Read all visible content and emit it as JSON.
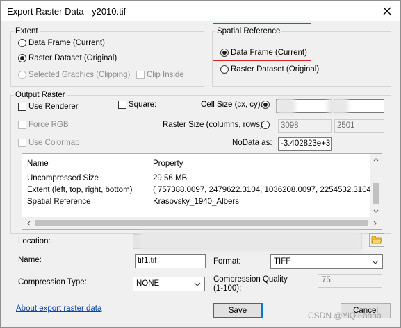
{
  "window": {
    "title": "Export Raster Data - y2010.tif"
  },
  "extent": {
    "legend": "Extent",
    "options": [
      {
        "label": "Data Frame (Current)",
        "checked": false
      },
      {
        "label": "Raster Dataset (Original)",
        "checked": true
      },
      {
        "label": "Selected Graphics (Clipping)",
        "checked": false,
        "disabled": true
      }
    ],
    "clip_inside": "Clip Inside"
  },
  "spatial_reference": {
    "legend": "Spatial Reference",
    "options": [
      {
        "label": "Data Frame (Current)",
        "checked": true
      },
      {
        "label": "Raster Dataset (Original)",
        "checked": false
      }
    ]
  },
  "output_raster": {
    "legend": "Output Raster",
    "use_renderer": "Use Renderer",
    "square": "Square:",
    "cell_size_label": "Cell Size (cx, cy):",
    "force_rgb": "Force RGB",
    "raster_size_label": "Raster Size (columns, rows):",
    "raster_columns": "3098",
    "raster_rows": "2501",
    "use_colormap": "Use Colormap",
    "nodata_label": "NoData as:",
    "nodata_value": "-3.402823e+3"
  },
  "properties": {
    "columns": [
      "Name",
      "Property"
    ],
    "rows": [
      {
        "name": "Uncompressed Size",
        "value": "29.56 MB"
      },
      {
        "name": "Extent (left, top, right, bottom)",
        "value": "( 757388.0097, 2479622.3104, 1036208.0097, 2254532.3104 )"
      },
      {
        "name": "Spatial Reference",
        "value": "Krasovsky_1940_Albers"
      }
    ]
  },
  "location": {
    "label": "Location:"
  },
  "name": {
    "label": "Name:",
    "value": "tif1.tif"
  },
  "format": {
    "label": "Format:",
    "value": "TIFF"
  },
  "compression": {
    "type_label": "Compression Type:",
    "type_value": "NONE",
    "quality_label_1": "Compression Quality",
    "quality_label_2": "(1-100):",
    "quality_value": "75"
  },
  "footer": {
    "about_link": "About export raster data",
    "save": "Save",
    "cancel": "Cancel"
  },
  "watermark": "CSDN @YiQiFaaaa"
}
